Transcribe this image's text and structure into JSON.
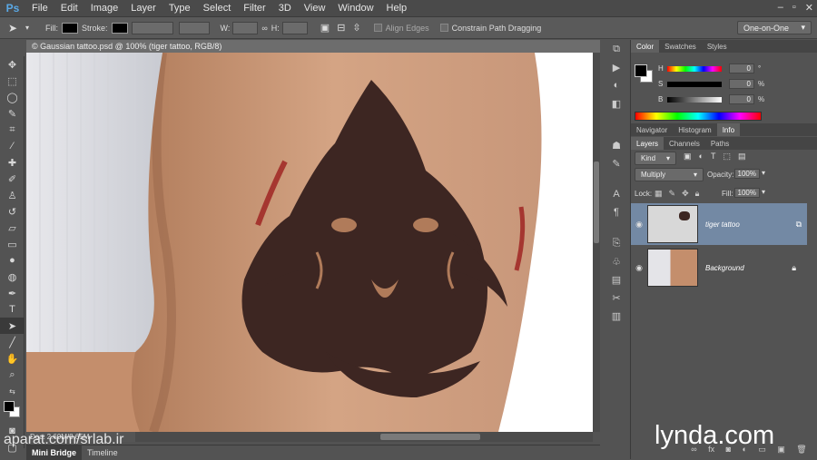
{
  "app": {
    "logo": "Ps"
  },
  "menu": [
    "File",
    "Edit",
    "Image",
    "Layer",
    "Type",
    "Select",
    "Filter",
    "3D",
    "View",
    "Window",
    "Help"
  ],
  "window_controls": {
    "minimize": "–",
    "restore": "▫",
    "close": "✕"
  },
  "options": {
    "fill_label": "Fill:",
    "stroke_label": "Stroke:",
    "w_label": "W:",
    "h_label": "H:",
    "align_edges": "Align Edges",
    "constrain": "Constrain Path Dragging",
    "workspace": "One-on-One"
  },
  "document": {
    "tab_title": "© Gaussian tattoo.psd @ 100% (tiger tattoo, RGB/8)",
    "status": "Doc: 2.60M/8.65M"
  },
  "bottom_tabs": [
    "Mini Bridge",
    "Timeline"
  ],
  "color_panel": {
    "tabs": [
      "Color",
      "Swatches",
      "Styles"
    ],
    "channels": [
      {
        "label": "H",
        "value": "0",
        "unit": "°"
      },
      {
        "label": "S",
        "value": "0",
        "unit": "%"
      },
      {
        "label": "B",
        "value": "0",
        "unit": "%"
      }
    ]
  },
  "nav_panel": {
    "tabs": [
      "Navigator",
      "Histogram",
      "Info"
    ]
  },
  "layers_panel": {
    "tabs": [
      "Layers",
      "Channels",
      "Paths"
    ],
    "kind": "Kind",
    "blend_mode": "Multiply",
    "opacity_label": "Opacity:",
    "opacity": "100%",
    "lock_label": "Lock:",
    "fill_label": "Fill:",
    "fill": "100%",
    "layers": [
      {
        "name": "tiger tattoo",
        "selected": true
      },
      {
        "name": "Background",
        "selected": false
      }
    ]
  },
  "watermarks": {
    "left": "aparat.com/srlab.ir",
    "right": "lynda.com"
  },
  "colors": {
    "ui_bg": "#535353",
    "selection": "#7389a4",
    "ps_blue": "#5aa9e6"
  }
}
